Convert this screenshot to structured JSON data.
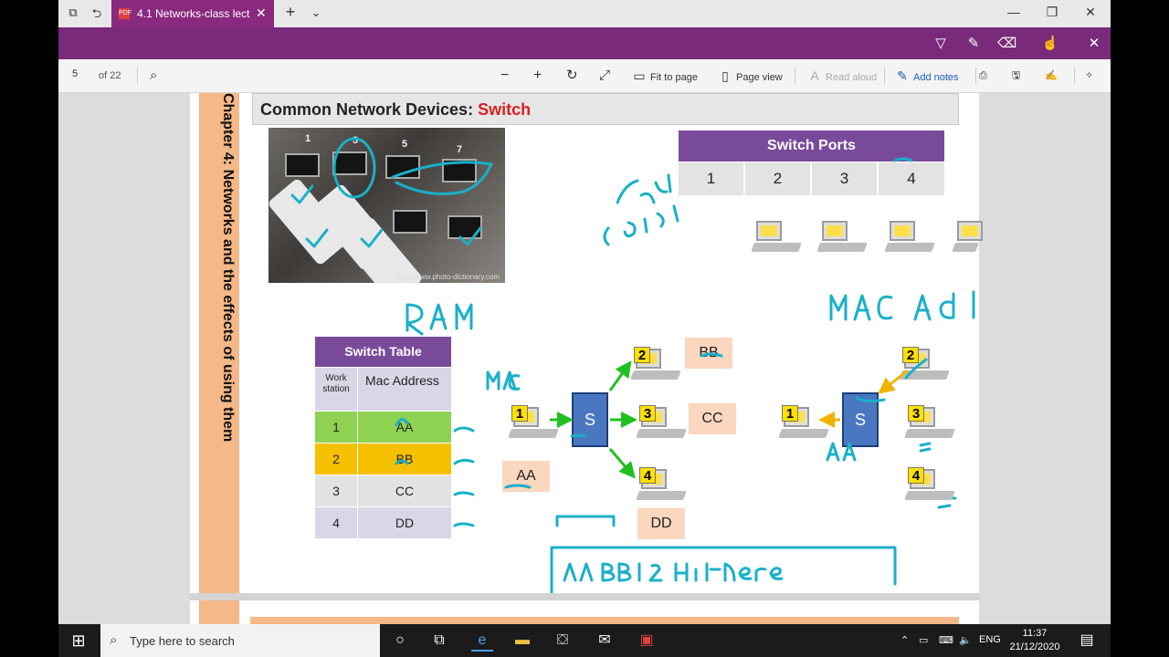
{
  "browser": {
    "tab_title": "4.1 Networks-class lectu",
    "tab_close": "✕",
    "new_tab": "+",
    "tab_list": "⌄",
    "minimize": "—",
    "restore": "❐",
    "close": "✕"
  },
  "pdf_toolbar": {
    "page_number": "5",
    "page_count": "of 22",
    "fit_to_page": "Fit to page",
    "page_view": "Page view",
    "read_aloud": "Read aloud",
    "add_notes": "Add notes"
  },
  "slide": {
    "side_title": "Chapter 4: Networks and the effects of using them",
    "heading_prefix": "Common Network Devices: ",
    "heading_highlight": "Switch",
    "photo_caption": "http://www.photo-dictionary.com",
    "photo_numbers": [
      "1",
      "3",
      "5",
      "7",
      "6"
    ],
    "switch_ports": {
      "title": "Switch Ports",
      "ports": [
        "1",
        "2",
        "3",
        "4"
      ]
    },
    "switch_table": {
      "title": "Switch Table",
      "col_workstation": "Work station",
      "col_mac": "Mac Address",
      "rows": [
        {
          "ws": "1",
          "mac": "AA",
          "color": "#8fd150"
        },
        {
          "ws": "2",
          "mac": "BB",
          "color": "#f5c000"
        },
        {
          "ws": "3",
          "mac": "CC",
          "color": "#e2e2e2"
        },
        {
          "ws": "4",
          "mac": "DD",
          "color": "#dad6e6"
        }
      ]
    },
    "diagram_left": {
      "switch_label": "S",
      "pcs": [
        "1",
        "2",
        "3",
        "4"
      ],
      "mac_labels": {
        "aa": "AA",
        "bb": "BB",
        "cc": "CC",
        "dd": "DD"
      }
    },
    "diagram_right": {
      "switch_label": "S",
      "pcs": [
        "1",
        "2",
        "3",
        "4"
      ]
    },
    "handwriting": [
      "Hard coded",
      "RAM",
      "MAC address",
      "MAC",
      "AA",
      "AA BB 1 2 Hi there"
    ]
  },
  "taskbar": {
    "search_placeholder": "Type here to search",
    "lang": "ENG",
    "time": "11:37",
    "date": "21/12/2020"
  },
  "colors": {
    "accent_purple": "#7a2a7a",
    "ink": "#1ab0c8",
    "table_purple": "#7a4a9a",
    "orange_strip": "#f5b888",
    "highlight_red": "#e01c1c"
  }
}
